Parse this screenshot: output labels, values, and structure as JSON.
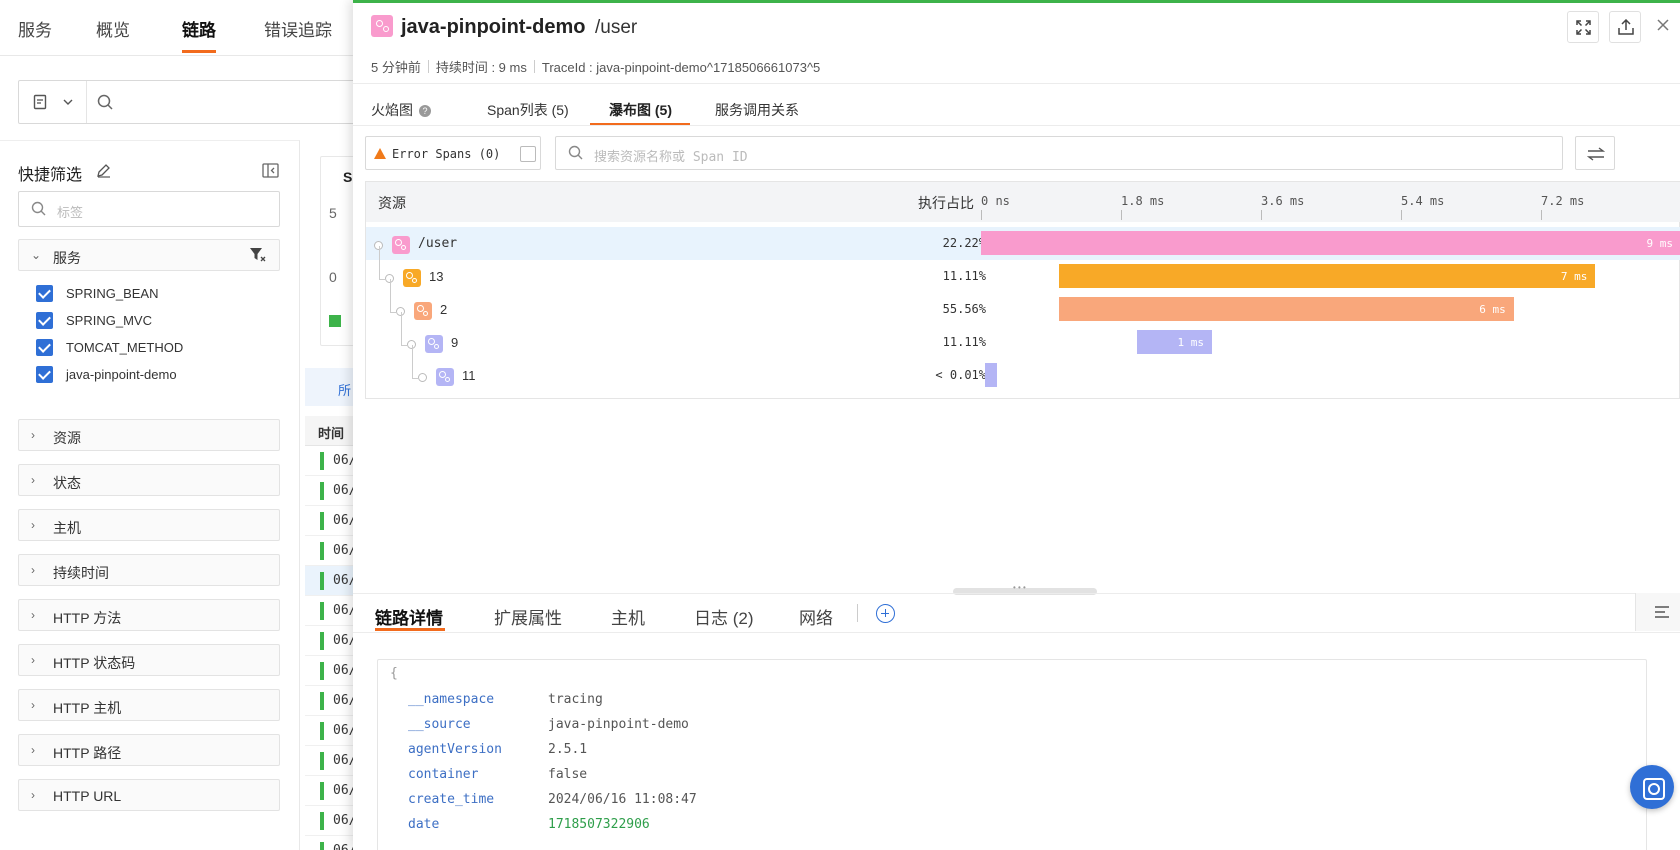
{
  "topnav": {
    "tabs": [
      {
        "label": "服务"
      },
      {
        "label": "概览"
      },
      {
        "label": "链路"
      },
      {
        "label": "错误追踪"
      }
    ]
  },
  "sidebar": {
    "title": "快捷筛选",
    "tag_placeholder": "标签",
    "service_facet": {
      "label": "服务",
      "items": [
        "SPRING_BEAN",
        "SPRING_MVC",
        "TOMCAT_METHOD",
        "java-pinpoint-demo"
      ]
    },
    "facets": [
      "资源",
      "状态",
      "主机",
      "持续时间",
      "HTTP 方法",
      "HTTP 状态码",
      "HTTP 主机",
      "HTTP 路径",
      "HTTP URL"
    ]
  },
  "background": {
    "card_tab": "Sp",
    "axis_5": "5",
    "axis_0": "0",
    "filter_tab": "所",
    "time_header": "时间",
    "time_cells": [
      "06/",
      "06/",
      "06/",
      "06/",
      "06/",
      "06/",
      "06/",
      "06/",
      "06/",
      "06/",
      "06/",
      "06/",
      "06/",
      "06/"
    ]
  },
  "drawer": {
    "service": "java-pinpoint-demo",
    "path": "/user",
    "meta": {
      "ago": "5 分钟前",
      "duration": "持续时间 : 9 ms",
      "trace_id": "TraceId : java-pinpoint-demo^1718506661073^5"
    },
    "tabs": [
      "火焰图",
      "Span列表 (5)",
      "瀑布图 (5)",
      "服务调用关系"
    ],
    "error_spans_label": "Error Spans (0)",
    "span_search_placeholder": "搜索资源名称或 Span ID",
    "waterfall": {
      "col_resource": "资源",
      "col_ratio": "执行占比",
      "ticks": [
        "0 ns",
        "1.8 ms",
        "3.6 ms",
        "5.4 ms",
        "7.2 ms"
      ],
      "rows": [
        {
          "name": "/user",
          "ratio": "22.22%",
          "bar_label": "9 ms",
          "color": "#f99bcd",
          "start_ms": 0,
          "end_ms": 9.0
        },
        {
          "name": "13",
          "ratio": "11.11%",
          "bar_label": "7 ms",
          "color": "#f8a927",
          "start_ms": 1.0,
          "end_ms": 7.9
        },
        {
          "name": "2",
          "ratio": "55.56%",
          "bar_label": "6 ms",
          "color": "#f9a77b",
          "start_ms": 1.0,
          "end_ms": 6.85
        },
        {
          "name": "9",
          "ratio": "11.11%",
          "bar_label": "1 ms",
          "color": "#b4b5f5",
          "start_ms": 2.0,
          "end_ms": 2.97
        },
        {
          "name": "11",
          "ratio": "< 0.01%",
          "bar_label": "",
          "color": "#b4b5f5",
          "start_ms": 0.05,
          "end_ms": 0.2
        }
      ]
    },
    "detail_tabs": [
      "链路详情",
      "扩展属性",
      "主机",
      "日志 (2)",
      "网络"
    ],
    "json_open": "{",
    "json_fields": [
      {
        "key": "__namespace",
        "value": "tracing",
        "type": "string"
      },
      {
        "key": "__source",
        "value": "java-pinpoint-demo",
        "type": "string"
      },
      {
        "key": "agentVersion",
        "value": "2.5.1",
        "type": "string"
      },
      {
        "key": "container",
        "value": "false",
        "type": "string"
      },
      {
        "key": "create_time",
        "value": "2024/06/16 11:08:47",
        "type": "string"
      },
      {
        "key": "date",
        "value": "1718507322906",
        "type": "number"
      }
    ]
  },
  "colors": {
    "accent": "#f26b1d",
    "brand_blue": "#2f6fd6",
    "service_pink": "#f99bcd",
    "ok_green": "#3db34a"
  }
}
